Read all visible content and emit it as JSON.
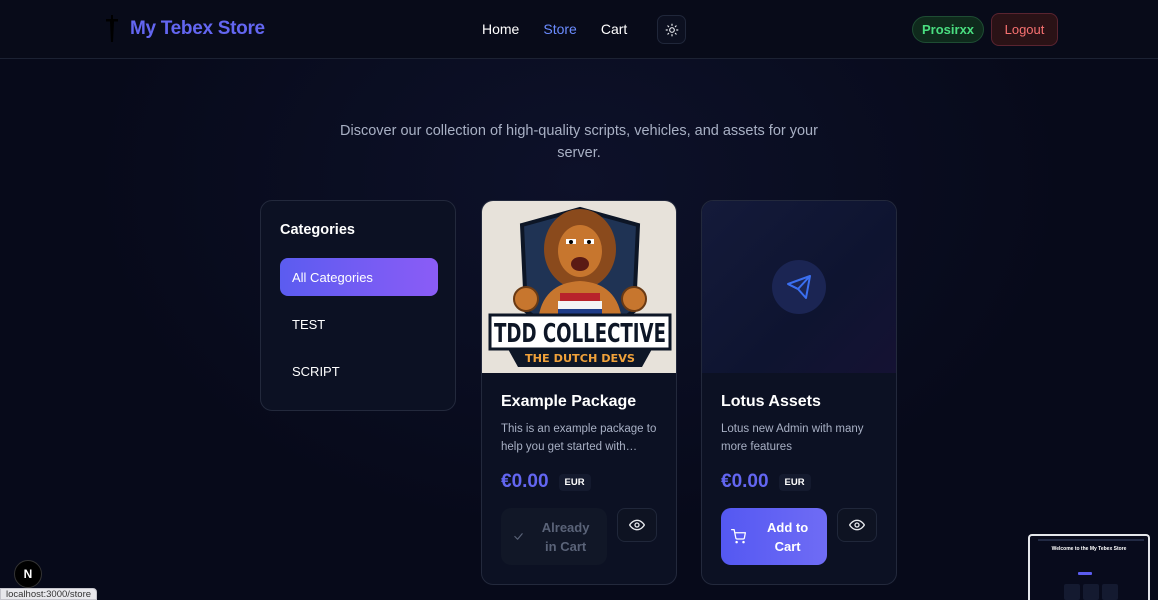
{
  "header": {
    "brand_title": "My Tebex Store",
    "brand_icon": "dagger-icon",
    "nav": [
      {
        "label": "Home",
        "active": false
      },
      {
        "label": "Store",
        "active": true
      },
      {
        "label": "Cart",
        "active": false
      }
    ],
    "theme_icon": "sun-icon",
    "username": "Prosirxx",
    "logout_label": "Logout"
  },
  "intro": {
    "text": "Discover our collection of high-quality scripts, vehicles, and assets for your server."
  },
  "categories": {
    "title": "Categories",
    "items": [
      {
        "label": "All Categories",
        "active": true
      },
      {
        "label": "TEST",
        "active": false
      },
      {
        "label": "SCRIPT",
        "active": false
      }
    ]
  },
  "products": [
    {
      "title": "Example Package",
      "description": "This is an example package to help you get started with Tebex",
      "price": "€0.00",
      "currency": "EUR",
      "image_text": [
        "TDD COLLECTIVE",
        "THE DUTCH DEVS"
      ],
      "cart_label": "Already in Cart",
      "cart_state": "disabled"
    },
    {
      "title": "Lotus Assets",
      "description": "Lotus new Admin with many more features",
      "price": "€0.00",
      "currency": "EUR",
      "cart_label": "Add to Cart",
      "cart_state": "enabled"
    }
  ],
  "overlay": {
    "framework_badge": "N",
    "status_url": "localhost:3000/store",
    "preview_title": "Welcome to the My Tebex Store"
  },
  "colors": {
    "accent": "#6366f1",
    "background": "#070a1a",
    "success": "#4ade80",
    "danger": "#f87171"
  }
}
